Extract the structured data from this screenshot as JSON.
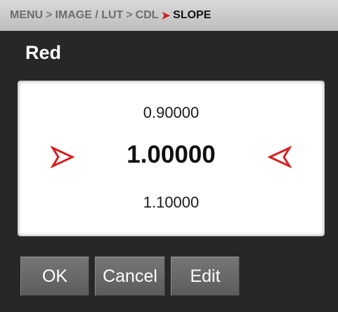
{
  "breadcrumb": {
    "items": [
      "MENU",
      "IMAGE / LUT",
      "CDL"
    ],
    "separator": ">",
    "active_separator": "➤",
    "current": "SLOPE"
  },
  "channel": {
    "title": "Red"
  },
  "value_selector": {
    "previous": "0.90000",
    "current": "1.00000",
    "next": "1.10000",
    "left_arrow_icon": "increment-arrow-icon",
    "right_arrow_icon": "decrement-arrow-icon",
    "accent_color": "#d51f1f"
  },
  "buttons": {
    "ok": "OK",
    "cancel": "Cancel",
    "edit": "Edit"
  }
}
